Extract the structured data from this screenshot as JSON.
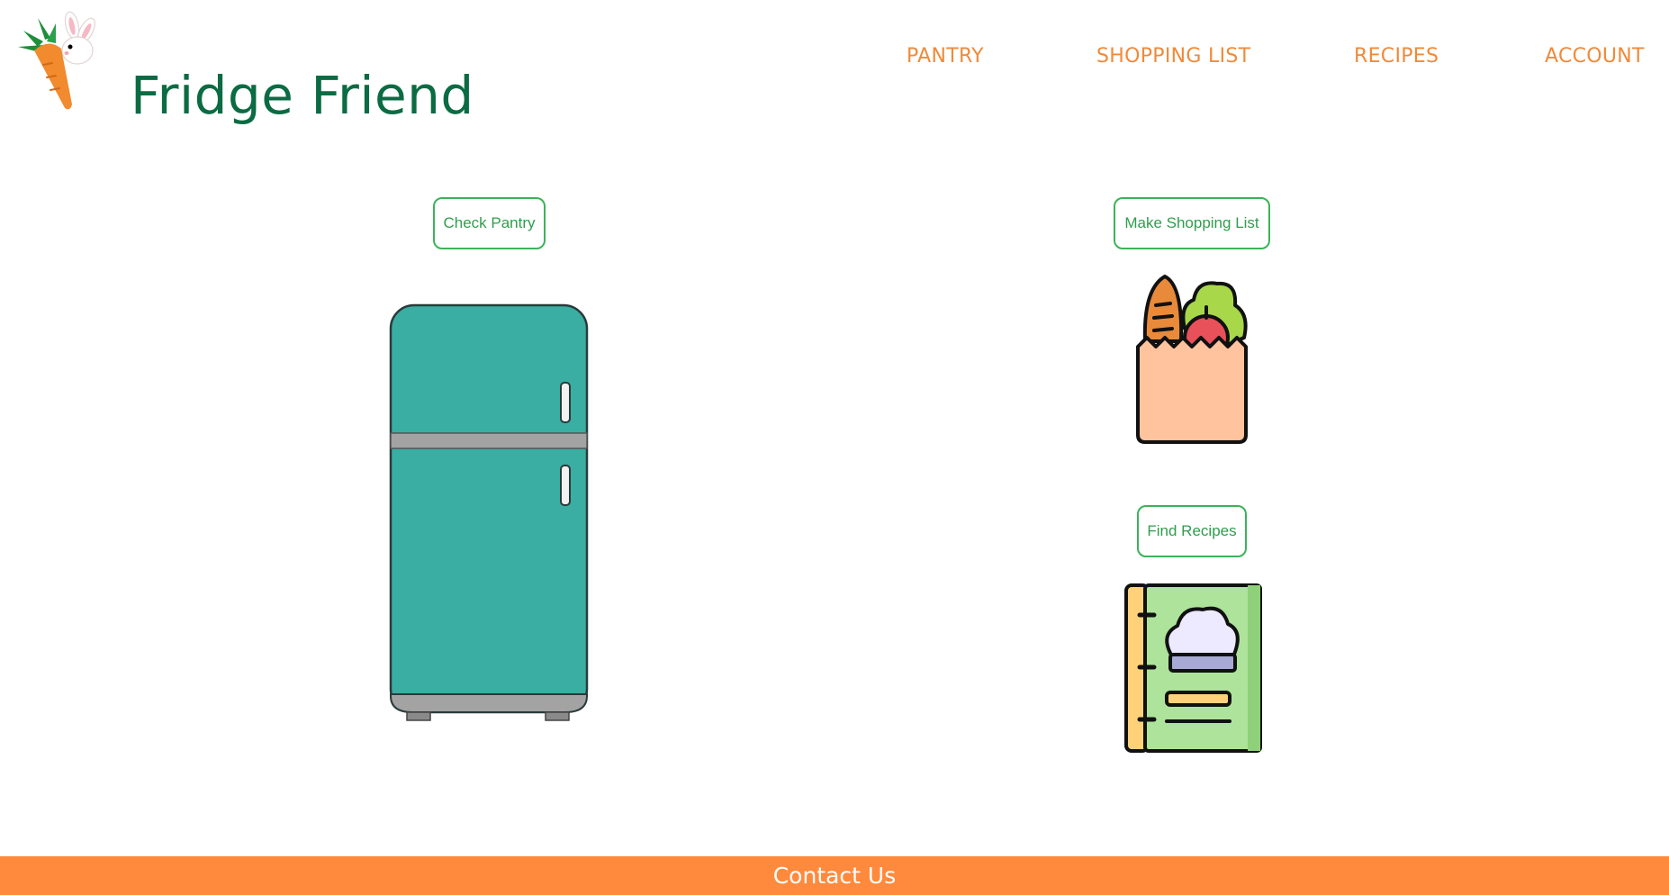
{
  "header": {
    "title": "Fridge Friend",
    "logo_icon": "carrot-bunny-icon"
  },
  "nav": {
    "items": [
      {
        "label": "PANTRY"
      },
      {
        "label": "SHOPPING LIST"
      },
      {
        "label": "RECIPES"
      },
      {
        "label": "ACCOUNT"
      }
    ]
  },
  "main": {
    "pantry_button": "Check Pantry",
    "shopping_button": "Make Shopping List",
    "recipes_button": "Find Recipes",
    "icons": [
      "fridge-icon",
      "grocery-bag-icon",
      "recipe-book-icon"
    ]
  },
  "footer": {
    "contact_label": "Contact Us"
  },
  "colors": {
    "brand_green": "#0b6b43",
    "nav_orange": "#f08a3a",
    "button_green": "#3bb35a",
    "footer_orange": "#ff8a3d",
    "fridge_teal": "#3aaea2"
  }
}
